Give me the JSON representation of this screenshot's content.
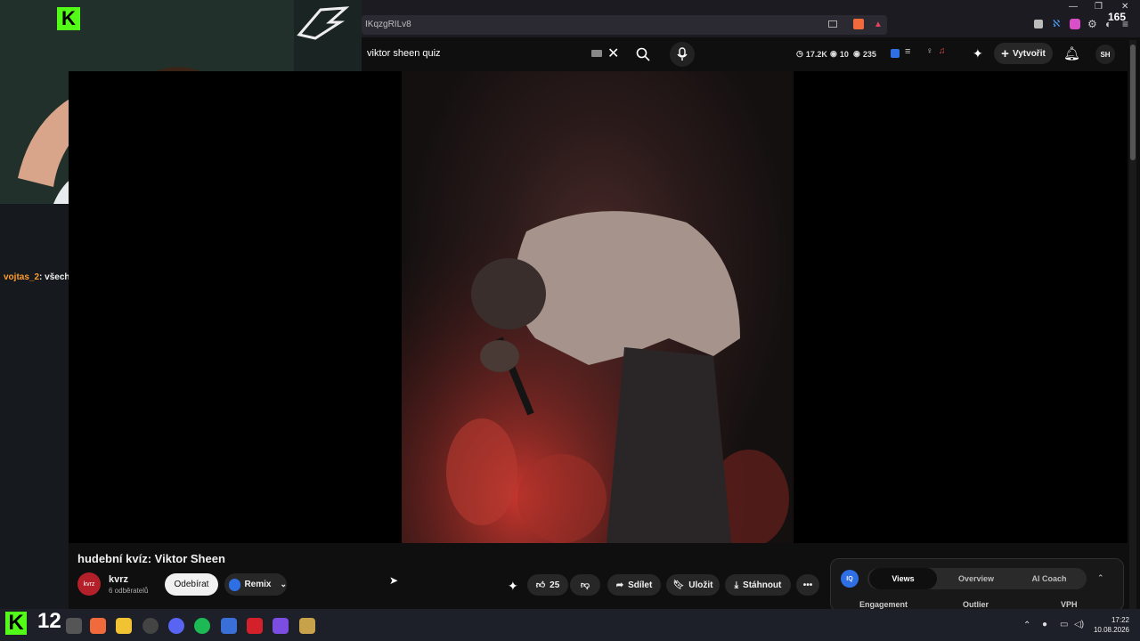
{
  "browser": {
    "address_fragment": "IKqzgRILv8",
    "fps_counter": "165",
    "window_controls": [
      "minimize",
      "restore",
      "close"
    ]
  },
  "youtube_header": {
    "search_query": "viktor sheen quiz",
    "stats": [
      {
        "icon": "clock-icon",
        "value": "17.2K"
      },
      {
        "icon": "eye-icon",
        "value": "10"
      },
      {
        "icon": "eye-icon",
        "value": "235"
      }
    ],
    "create_label": "Vytvořit"
  },
  "stream_overlay": {
    "chat_user": "vojtas_2",
    "chat_message": ": všechno jsem viděl",
    "viewer_count": "12"
  },
  "video": {
    "title": "hudební kvíz: Viktor Sheen",
    "channel_name": "kvrz",
    "channel_avatar_text": "kvrz",
    "subscribers": "6 odběratelů",
    "subscribe_label": "Odebírat",
    "remix_label": "Remix",
    "like_count": "25",
    "share_label": "Sdílet",
    "save_label": "Uložit",
    "download_label": "Stáhnout"
  },
  "analytics_panel": {
    "tabs": [
      "Views",
      "Overview",
      "AI Coach"
    ],
    "active_tab": "Views",
    "columns": [
      "Engagement",
      "Outlier",
      "VPH"
    ]
  },
  "taskbar": {
    "time": "17:22",
    "date": "10.08.2026"
  },
  "colors": {
    "kick_green": "#53fc18",
    "background": "#0f0f0f",
    "pill": "#272727"
  }
}
